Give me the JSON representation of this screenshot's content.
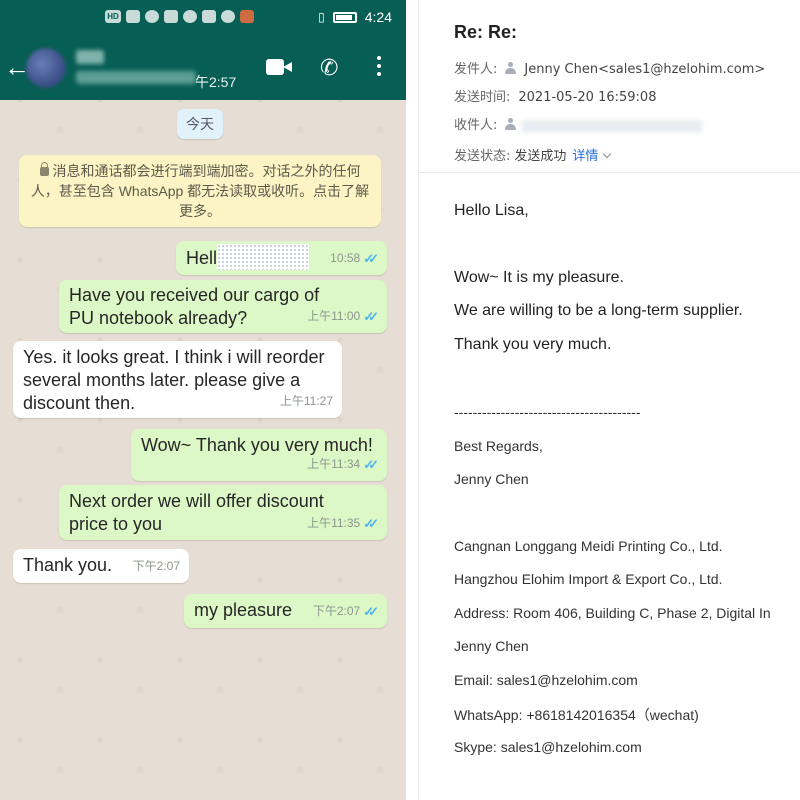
{
  "whatsapp": {
    "status_bar": {
      "time": "4:24"
    },
    "header": {
      "last_seen_suffix": "午2:57"
    },
    "day_chip": "今天",
    "encryption_note": "消息和通话都会进行端到端加密。对话之外的任何人，甚至包含 WhatsApp 都无法读取或收听。点击了解更多。",
    "messages": [
      {
        "direction": "out",
        "text": "Hell",
        "time": "10:58",
        "redacted": true
      },
      {
        "direction": "out",
        "text": "Have you received our cargo of PU notebook already?",
        "time": "上午11:00"
      },
      {
        "direction": "in",
        "text": "Yes. it looks great. I think i will reorder several months later. please give a discount then.",
        "time": "上午11:27"
      },
      {
        "direction": "out",
        "text": "Wow~ Thank you very much!",
        "time": "上午11:34"
      },
      {
        "direction": "out",
        "text": "Next order we will offer discount price to you",
        "time": "上午11:35"
      },
      {
        "direction": "in",
        "text": "Thank you.",
        "time": "下午2:07"
      },
      {
        "direction": "out",
        "text": "my pleasure",
        "time": "下午2:07"
      }
    ]
  },
  "email": {
    "subject": "Re: Re:",
    "from_label": "发件人:",
    "from_value": "Jenny Chen<sales1@hzelohim.com>",
    "sent_label": "发送时间:",
    "sent_value": "2021-05-20 16:59:08",
    "to_label": "收件人:",
    "status_label": "发送状态:",
    "status_value": "发送成功",
    "details_link": "详情",
    "body": [
      "Hello Lisa,",
      "Wow~ It is my pleasure.",
      "We are willing to be a long-term supplier.",
      "Thank you very much."
    ],
    "signature": {
      "divider": "----------------------------------------",
      "regards": "Best Regards,",
      "name": "Jenny Chen",
      "company1": "Cangnan Longgang Meidi Printing Co., Ltd.",
      "company2": "Hangzhou Elohim Import & Export Co., Ltd.",
      "address": "Address: Room 406, Building C, Phase 2, Digital In",
      "name2": "Jenny Chen",
      "email": "Email: sales1@hzelohim.com",
      "whatsapp": "WhatsApp: +8618142016354（wechat)",
      "skype": "Skype: sales1@hzelohim.com"
    }
  }
}
